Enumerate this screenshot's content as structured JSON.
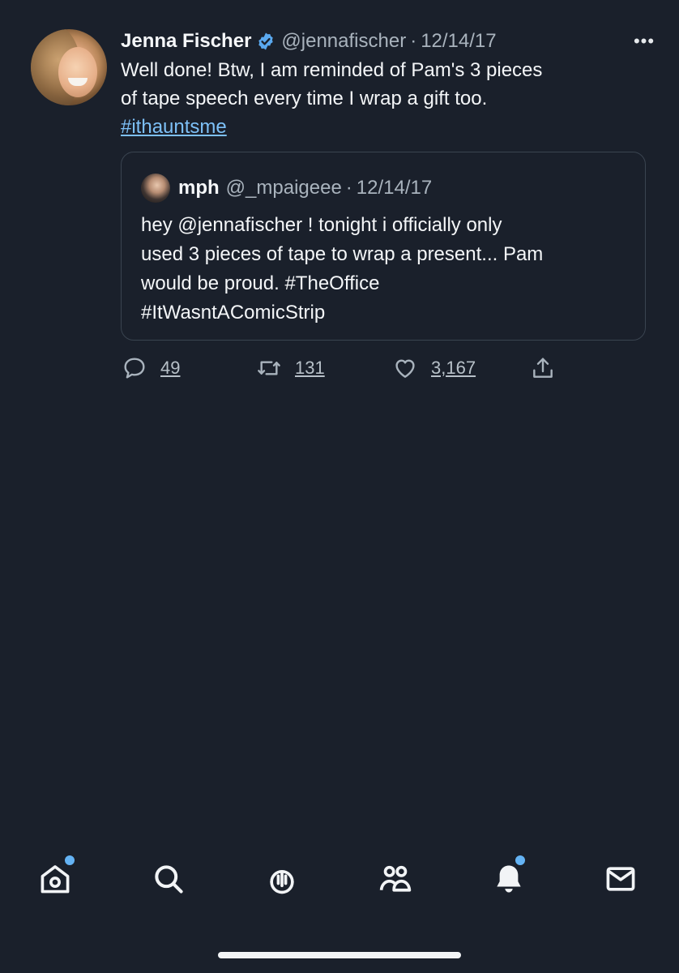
{
  "tweet": {
    "author": {
      "name": "Jenna Fischer",
      "handle": "@jennafischer",
      "verified": true
    },
    "separator": "·",
    "date": "12/14/17",
    "more_label": "•••",
    "text_lines": [
      "Well done! Btw, I am reminded of Pam's 3 pieces",
      "of tape speech every time I wrap a gift too."
    ],
    "hashtag": "#ithauntsme"
  },
  "quoted_tweet": {
    "author": {
      "name": "mph",
      "handle": "@_mpaigeee"
    },
    "separator": "·",
    "date": "12/14/17",
    "text_lines": [
      "hey @jennafischer ! tonight i officially only",
      "used 3 pieces of tape to wrap a present... Pam",
      "would be proud. #TheOffice",
      "#ItWasntAComicStrip"
    ]
  },
  "actions": {
    "reply_count": "49",
    "retweet_count": "131",
    "like_count": "3,167"
  },
  "bottom_nav": {
    "items": [
      {
        "icon": "home-icon",
        "has_dot": true
      },
      {
        "icon": "search-icon",
        "has_dot": false
      },
      {
        "icon": "spaces-icon",
        "has_dot": false
      },
      {
        "icon": "communities-icon",
        "has_dot": false
      },
      {
        "icon": "notifications-icon",
        "has_dot": true
      },
      {
        "icon": "messages-icon",
        "has_dot": false
      }
    ]
  },
  "colors": {
    "background": "#1a202b",
    "accent": "#7dc0f7",
    "verified": "#5aa9f0",
    "notification_dot": "#64b3f4",
    "muted_text": "#a9b3bd"
  }
}
